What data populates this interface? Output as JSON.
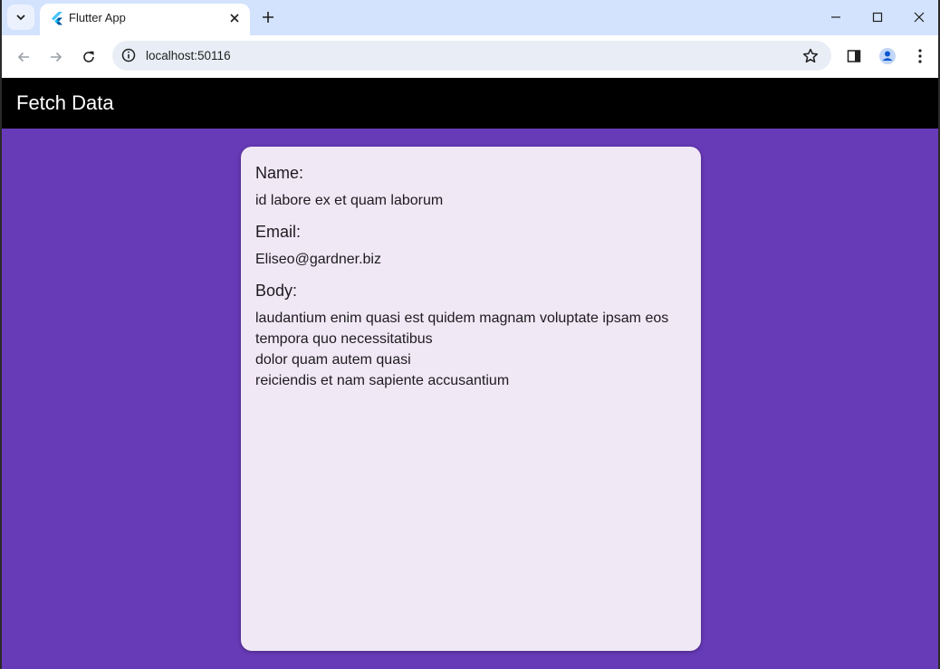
{
  "browser": {
    "tab_title": "Flutter App",
    "url": "localhost:50116"
  },
  "app": {
    "title": "Fetch Data"
  },
  "card": {
    "name_label": "Name:",
    "name_value": "id labore ex et quam laborum",
    "email_label": "Email:",
    "email_value": "Eliseo@gardner.biz",
    "body_label": "Body:",
    "body_value": "laudantium enim quasi est quidem magnam voluptate ipsam eos\ntempora quo necessitatibus\ndolor quam autem quasi\nreiciendis et nam sapiente accusantium"
  },
  "colors": {
    "background": "#673ab7",
    "appbar": "#000000",
    "card": "#f0e8f5",
    "tabstrip": "#d3e3fd"
  },
  "icons": [
    "tab-search-icon",
    "flutter-logo-icon",
    "close-icon",
    "plus-icon",
    "minimize-icon",
    "maximize-icon",
    "window-close-icon",
    "back-arrow-icon",
    "forward-arrow-icon",
    "reload-icon",
    "site-info-icon",
    "star-icon",
    "side-panel-icon",
    "profile-icon",
    "more-vert-icon"
  ]
}
